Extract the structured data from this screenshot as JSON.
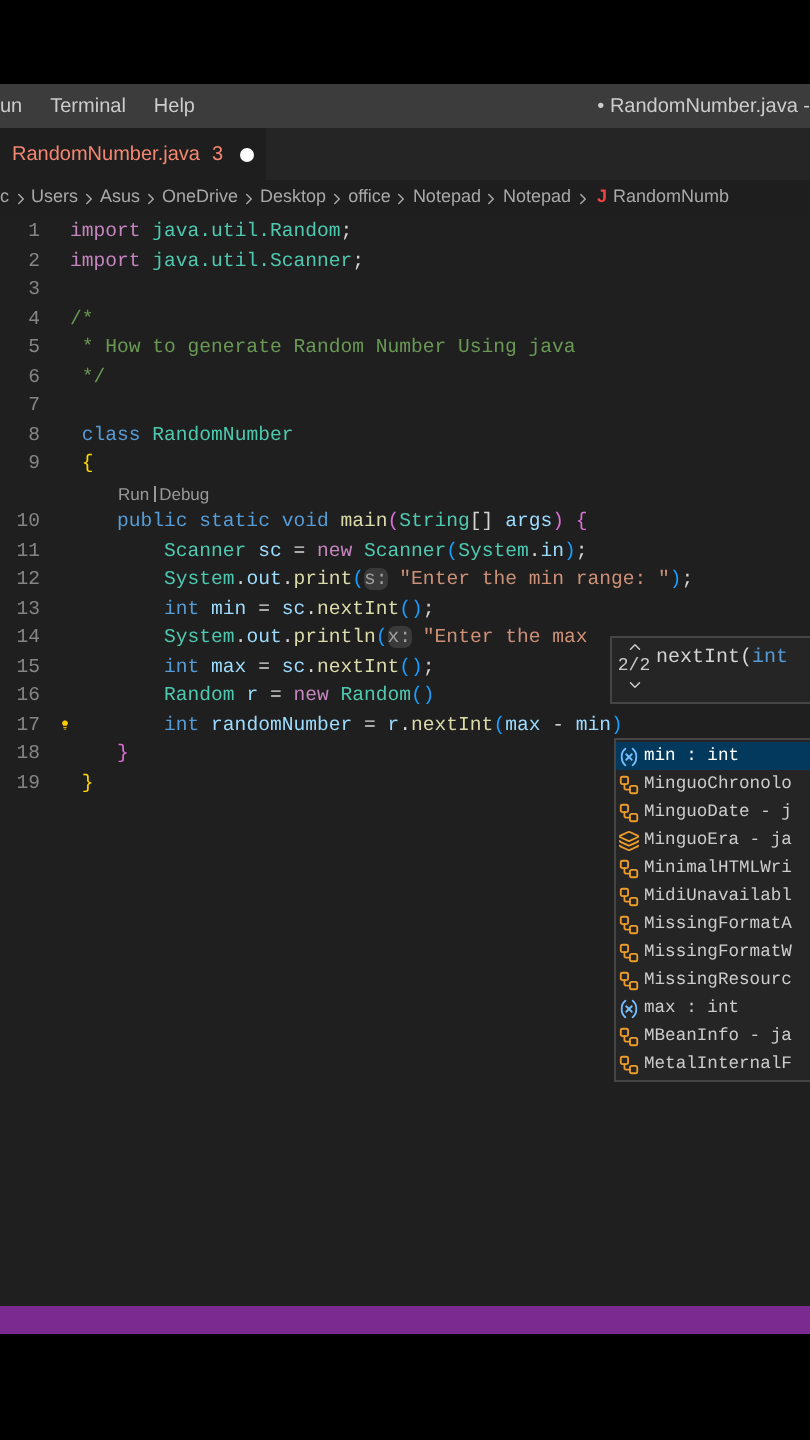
{
  "menu": [
    "un",
    "Terminal",
    "Help"
  ],
  "window": {
    "title": "• RandomNumber.java -"
  },
  "tabs": [
    {
      "label": "RandomNumber.java",
      "badge": "3",
      "modified": true,
      "selected": true
    }
  ],
  "breadcrumbs": {
    "segments": [
      "c",
      "Users",
      "Asus",
      "OneDrive",
      "Desktop",
      "office",
      "Notepad",
      "Notepad"
    ],
    "file_icon": "J",
    "file": "RandomNumb"
  },
  "editor": {
    "lines": [
      {
        "kind": "code",
        "number": "1",
        "tokens": [
          {
            "t": "import",
            "color": "#c586c0"
          },
          {
            "t": " java.util.Random",
            "color": "#4ec9b0"
          },
          {
            "t": ";"
          }
        ]
      },
      {
        "kind": "code",
        "number": "2",
        "tokens": [
          {
            "t": "import",
            "color": "#c586c0"
          },
          {
            "t": " java.util.Scanner",
            "color": "#4ec9b0"
          },
          {
            "t": ";"
          }
        ]
      },
      {
        "kind": "code",
        "number": "3"
      },
      {
        "kind": "code",
        "number": "4",
        "tokens": [
          {
            "t": "/*",
            "color": "#6a9955"
          }
        ]
      },
      {
        "kind": "code",
        "number": "5",
        "tokens": [
          {
            "t": " * How to generate Random Number Using java",
            "color": "#6a9955"
          }
        ]
      },
      {
        "kind": "code",
        "number": "6",
        "tokens": [
          {
            "t": " */",
            "color": "#6a9955"
          }
        ]
      },
      {
        "kind": "code",
        "number": "7"
      },
      {
        "kind": "code",
        "number": "8",
        "tokens": [
          {
            "t": " class",
            "color": "#569cd6"
          },
          {
            "t": " RandomNumber",
            "color": "#4ec9b0"
          }
        ]
      },
      {
        "kind": "code",
        "number": "9",
        "tokens": [
          {
            "t": " {",
            "color": "#ffd700"
          }
        ]
      },
      {
        "kind": "codelens",
        "links": [
          "Run",
          "Debug"
        ]
      },
      {
        "kind": "code",
        "number": "10",
        "tokens": [
          {
            "t": "    public static void",
            "color": "#569cd6"
          },
          {
            "t": " main",
            "color": "#dcdcaa"
          },
          {
            "t": "(",
            "color": "#da70d6"
          },
          {
            "t": "String",
            "color": "#4ec9b0"
          },
          {
            "t": "[]"
          },
          {
            "t": " args",
            "color": "#9cdcfe"
          },
          {
            "t": ") {",
            "color": "#da70d6"
          }
        ]
      },
      {
        "kind": "code",
        "number": "11",
        "tokens": [
          {
            "t": "        Scanner",
            "color": "#4ec9b0"
          },
          {
            "t": " sc",
            "color": "#9cdcfe"
          },
          {
            "t": " ="
          },
          {
            "t": " new",
            "color": "#c586c0"
          },
          {
            "t": " Scanner",
            "color": "#4ec9b0"
          },
          {
            "t": "(",
            "color": "#179fff"
          },
          {
            "t": "System",
            "color": "#4ec9b0"
          },
          {
            "t": "."
          },
          {
            "t": "in",
            "color": "#9cdcfe"
          },
          {
            "t": ")",
            "color": "#179fff"
          },
          {
            "t": ";"
          }
        ]
      },
      {
        "kind": "code",
        "number": "12",
        "tokens": [
          {
            "t": "        System",
            "color": "#4ec9b0"
          },
          {
            "t": "."
          },
          {
            "t": "out",
            "color": "#9cdcfe"
          },
          {
            "t": "."
          },
          {
            "t": "print",
            "color": "#dcdcaa"
          },
          {
            "t": "(",
            "color": "#179fff"
          },
          {
            "kind": "hint",
            "t": "s:"
          },
          {
            "t": " \"Enter the min range: \"",
            "color": "#ce9178"
          },
          {
            "t": ")",
            "color": "#179fff"
          },
          {
            "t": ";"
          }
        ]
      },
      {
        "kind": "code",
        "number": "13",
        "tokens": [
          {
            "t": "        int",
            "color": "#569cd6"
          },
          {
            "t": " min",
            "color": "#9cdcfe"
          },
          {
            "t": " ="
          },
          {
            "t": " sc",
            "color": "#9cdcfe"
          },
          {
            "t": "."
          },
          {
            "t": "nextInt",
            "color": "#dcdcaa"
          },
          {
            "t": "()",
            "color": "#179fff"
          },
          {
            "t": ";"
          }
        ]
      },
      {
        "kind": "code",
        "number": "14",
        "tokens": [
          {
            "t": "        System",
            "color": "#4ec9b0"
          },
          {
            "t": "."
          },
          {
            "t": "out",
            "color": "#9cdcfe"
          },
          {
            "t": "."
          },
          {
            "t": "println",
            "color": "#dcdcaa"
          },
          {
            "t": "(",
            "color": "#179fff"
          },
          {
            "kind": "hint",
            "t": "x:"
          },
          {
            "t": " \"Enter the max",
            "color": "#ce9178"
          }
        ]
      },
      {
        "kind": "code",
        "number": "15",
        "tokens": [
          {
            "t": "        int",
            "color": "#569cd6"
          },
          {
            "t": " max",
            "color": "#9cdcfe"
          },
          {
            "t": " ="
          },
          {
            "t": " sc",
            "color": "#9cdcfe"
          },
          {
            "t": "."
          },
          {
            "t": "nextInt",
            "color": "#dcdcaa"
          },
          {
            "t": "()",
            "color": "#179fff"
          },
          {
            "t": ";"
          }
        ]
      },
      {
        "kind": "code",
        "number": "16",
        "tokens": [
          {
            "t": "        Random",
            "color": "#4ec9b0"
          },
          {
            "t": " r",
            "color": "#9cdcfe"
          },
          {
            "t": " ="
          },
          {
            "t": " new",
            "color": "#c586c0"
          },
          {
            "t": " Random",
            "color": "#4ec9b0"
          },
          {
            "t": "()",
            "color": "#179fff"
          }
        ]
      },
      {
        "kind": "code",
        "number": "17",
        "lightbulb": true,
        "tokens": [
          {
            "t": "        int",
            "color": "#569cd6"
          },
          {
            "t": " randomNumber",
            "color": "#9cdcfe"
          },
          {
            "t": " ="
          },
          {
            "t": " r",
            "color": "#9cdcfe"
          },
          {
            "t": "."
          },
          {
            "t": "nextInt",
            "color": "#dcdcaa"
          },
          {
            "t": "(",
            "color": "#179fff"
          },
          {
            "t": "max",
            "color": "#9cdcfe"
          },
          {
            "t": " -"
          },
          {
            "t": " min",
            "color": "#9cdcfe"
          },
          {
            "t": ")",
            "color": "#179fff"
          }
        ]
      },
      {
        "kind": "code",
        "number": "18",
        "tokens": [
          {
            "t": "    }",
            "color": "#da70d6"
          }
        ]
      },
      {
        "kind": "code",
        "number": "19",
        "tokens": [
          {
            "t": " }",
            "color": "#ffd700"
          }
        ]
      }
    ]
  },
  "signature_help": {
    "counter": "2/2",
    "label": "nextInt(",
    "param": "int"
  },
  "suggestions": [
    {
      "kind": "variable",
      "label": "min : int",
      "selected": true
    },
    {
      "kind": "class",
      "label": "MinguoChronolo",
      "selected": false
    },
    {
      "kind": "class",
      "label": "MinguoDate - j",
      "selected": false
    },
    {
      "kind": "enum",
      "label": "MinguoEra - ja",
      "selected": false
    },
    {
      "kind": "class",
      "label": "MinimalHTMLWri",
      "selected": false
    },
    {
      "kind": "class",
      "label": "MidiUnavailabl",
      "selected": false
    },
    {
      "kind": "class",
      "label": "MissingFormatA",
      "selected": false
    },
    {
      "kind": "class",
      "label": "MissingFormatW",
      "selected": false
    },
    {
      "kind": "class",
      "label": "MissingResourc",
      "selected": false
    },
    {
      "kind": "variable",
      "label": "max : int",
      "selected": false
    },
    {
      "kind": "class",
      "label": "MBeanInfo - ja",
      "selected": false
    },
    {
      "kind": "class",
      "label": "MetalInternalF",
      "selected": false
    }
  ]
}
